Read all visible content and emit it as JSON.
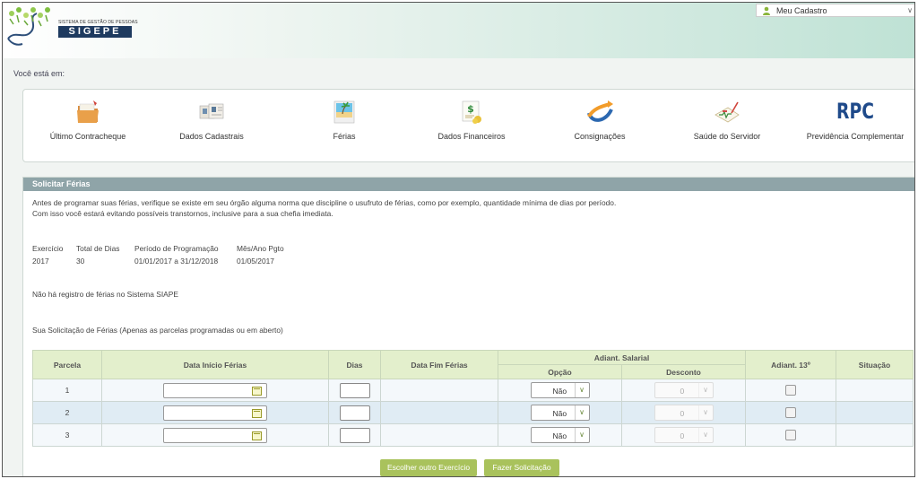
{
  "header": {
    "logo_subtitle": "SISTEMA DE GESTÃO DE PESSOAS",
    "logo_title": "SIGEPE",
    "user_menu_label": "Meu Cadastro"
  },
  "breadcrumb": {
    "label": "Você está em:"
  },
  "shortcuts": [
    {
      "label": "Último Contracheque",
      "icon": "folder-icon"
    },
    {
      "label": "Dados Cadastrais",
      "icon": "id-cards-icon"
    },
    {
      "label": "Férias",
      "icon": "beach-icon"
    },
    {
      "label": "Dados Financeiros",
      "icon": "money-icon"
    },
    {
      "label": "Consignações",
      "icon": "arrow-swoosh-icon"
    },
    {
      "label": "Saúde do Servidor",
      "icon": "health-icon"
    },
    {
      "label": "Previdência Complementar",
      "icon": "rpc-logo",
      "logo_text": "RPC"
    }
  ],
  "panel": {
    "title": "Solicitar Férias",
    "intro_line1": "Antes de programar suas férias, verifique se existe em seu órgão alguma norma que discipline o usufruto de férias, como por exemplo, quantidade mínima de dias por período.",
    "intro_line2": "Com isso você estará evitando possíveis transtornos, inclusive para a sua chefia imediata.",
    "exercise": {
      "headers": [
        "Exercício",
        "Total de Dias",
        "Período de Programação",
        "Mês/Ano Pgto"
      ],
      "values": [
        "2017",
        "30",
        "01/01/2017 a 31/12/2018",
        "01/05/2017"
      ]
    },
    "no_record": "Não há registro de férias no Sistema SIAPE",
    "request_label": "Sua Solicitação de Férias (Apenas as parcelas programadas ou em aberto)",
    "table": {
      "headers": {
        "parcela": "Parcela",
        "data_inicio": "Data Início Férias",
        "dias": "Dias",
        "data_fim": "Data Fim Férias",
        "adiant_salarial": "Adiant. Salarial",
        "opcao": "Opção",
        "desconto": "Desconto",
        "adiant_13": "Adiant. 13º",
        "situacao": "Situação"
      },
      "rows": [
        {
          "parcela": "1",
          "opcao": "Não",
          "desconto": "0"
        },
        {
          "parcela": "2",
          "opcao": "Não",
          "desconto": "0"
        },
        {
          "parcela": "3",
          "opcao": "Não",
          "desconto": "0"
        }
      ]
    },
    "buttons": {
      "other_exercise": "Escolher outro Exercício",
      "submit": "Fazer Solicitação"
    }
  },
  "colors": {
    "header_gradient_end": "#bfe2d5",
    "panel_title_bg": "#8fa4a8",
    "table_header_bg": "#e3efcc",
    "button_bg": "#a9c25c",
    "brand_dark": "#1e3a5f"
  }
}
